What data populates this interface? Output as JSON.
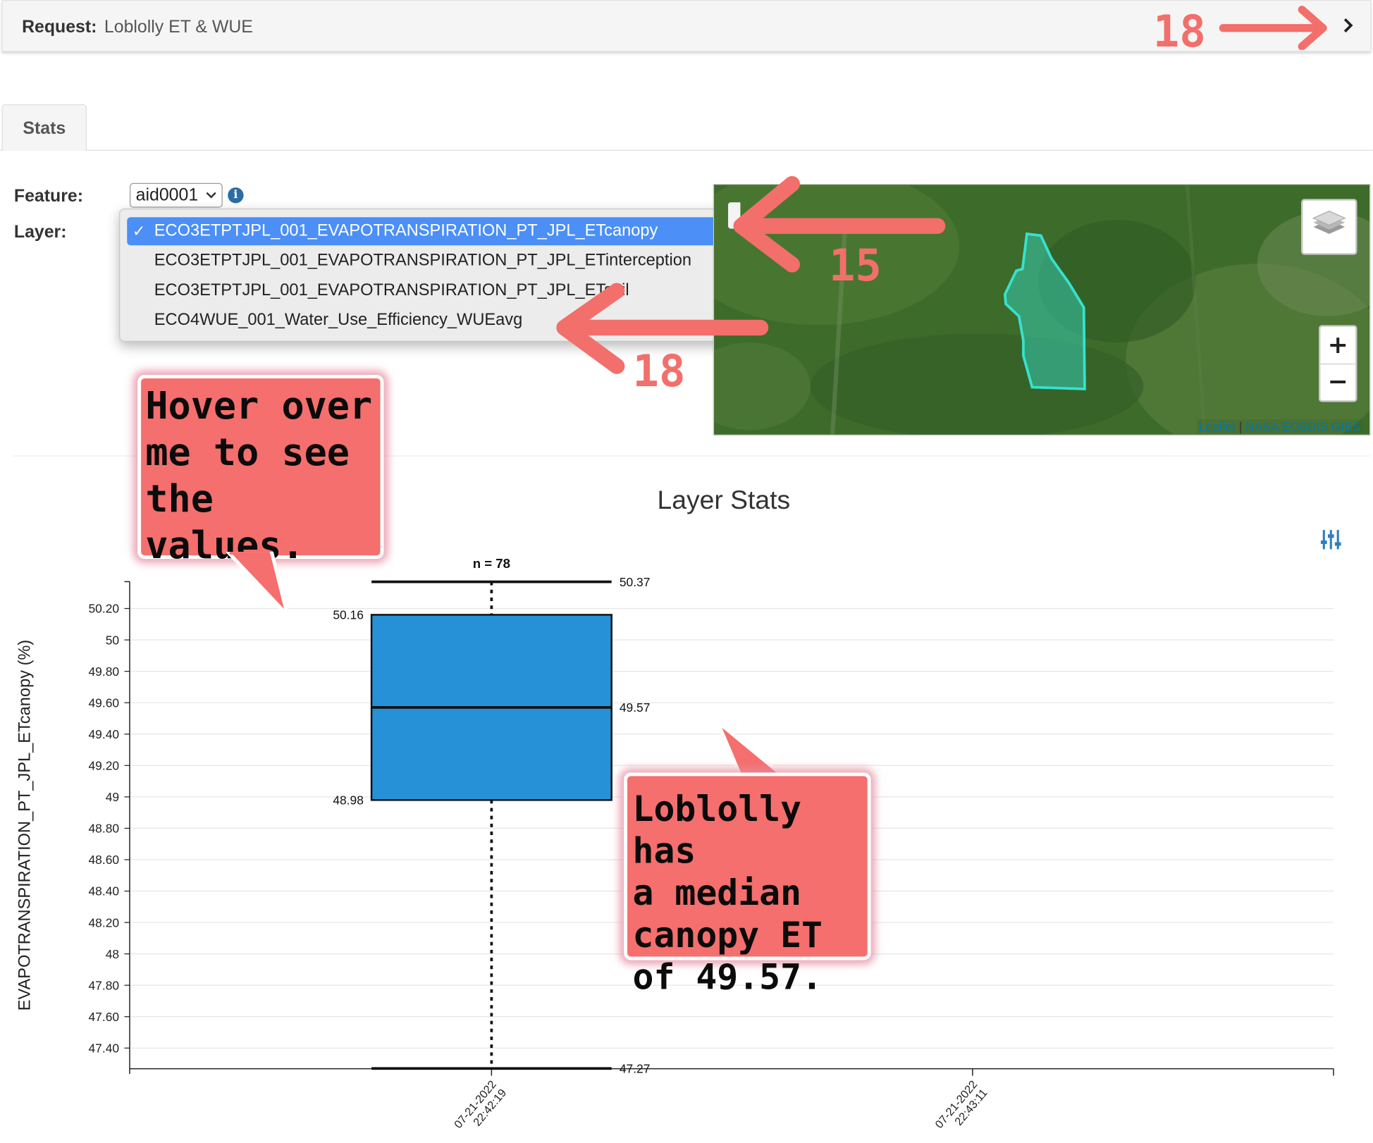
{
  "request": {
    "label": "Request:",
    "value": "Loblolly ET & WUE"
  },
  "tabs": [
    {
      "label": "Stats"
    }
  ],
  "form": {
    "feature_label": "Feature:",
    "feature_value": "aid0001",
    "layer_label": "Layer:",
    "layer_options": [
      "ECO3ETPTJPL_001_EVAPOTRANSPIRATION_PT_JPL_ETcanopy",
      "ECO3ETPTJPL_001_EVAPOTRANSPIRATION_PT_JPL_ETinterception",
      "ECO3ETPTJPL_001_EVAPOTRANSPIRATION_PT_JPL_ETsoil",
      "ECO4WUE_001_Water_Use_Efficiency_WUEavg"
    ],
    "layer_selected_index": 0
  },
  "map": {
    "attribution": [
      "Leaflet",
      "NASA EOSDIS GIBS"
    ],
    "zoom_in": "+",
    "zoom_out": "−",
    "polygon_color": "#36e2cf"
  },
  "annotations": {
    "arrow_top": "18",
    "arrow_canopy": "15",
    "arrow_wue": "18",
    "callout_hover": "Hover over\nme to see\nthe values.",
    "callout_median": "Loblolly has\na median\ncanopy ET\nof 49.57."
  },
  "colors": {
    "accent": "#f26f6b",
    "box_fill": "#2791d8",
    "selection": "#4b8ff7"
  },
  "chart_data": {
    "type": "box",
    "title": "Layer Stats",
    "ylabel": "EVAPOTRANSPIRATION_PT_JPL_ETcanopy (%)",
    "xlabel": "",
    "ylim": [
      47.27,
      50.37
    ],
    "yticks": [
      47.4,
      47.6,
      47.8,
      48,
      48.2,
      48.4,
      48.6,
      48.8,
      49,
      49.2,
      49.4,
      49.6,
      49.8,
      50,
      50.2
    ],
    "ytick_labels": [
      "47.40",
      "47.60",
      "47.80",
      "48",
      "48.20",
      "48.40",
      "48.60",
      "48.80",
      "49",
      "49.20",
      "49.40",
      "49.60",
      "49.80",
      "50",
      "50.20"
    ],
    "x_labels": [
      "07-21-2022\n22:42:19",
      "07-21-2022\n22:43:11"
    ],
    "grid": true,
    "boxes": [
      {
        "x_label_index": 0,
        "n_label": "n = 78",
        "min": 47.27,
        "q1": 48.98,
        "median": 49.57,
        "q3": 50.16,
        "max": 50.37,
        "labels": {
          "min": "47.27",
          "q1": "48.98",
          "median": "49.57",
          "q3": "50.16",
          "max": "50.37"
        }
      }
    ]
  }
}
